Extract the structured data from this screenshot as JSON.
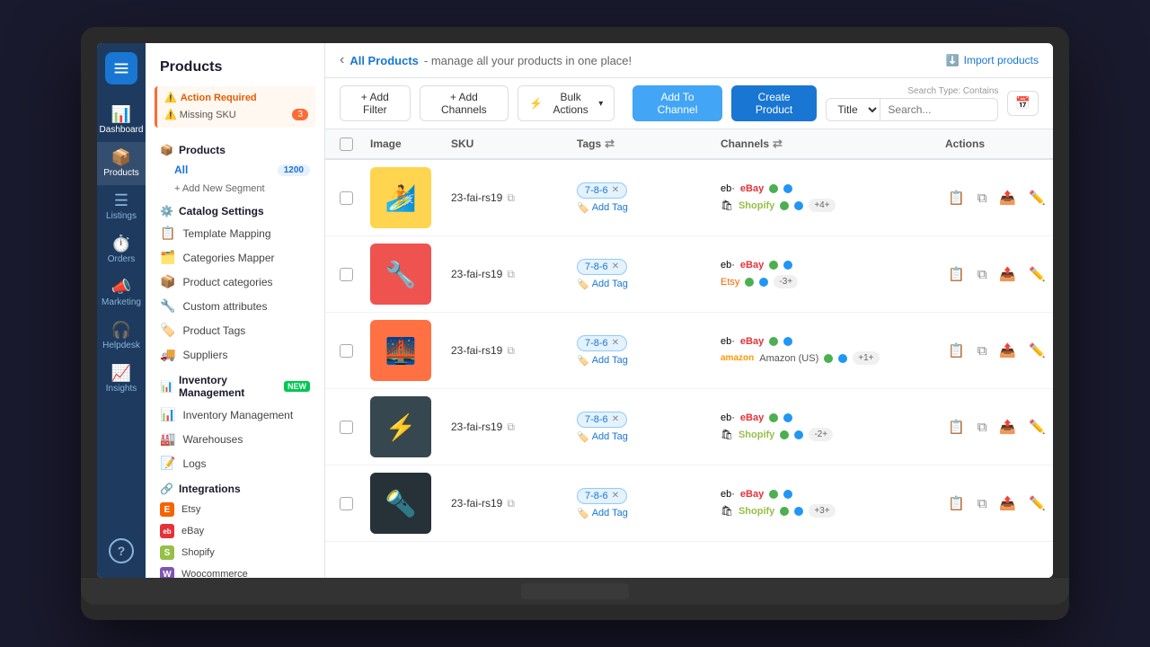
{
  "app": {
    "title": "Products"
  },
  "header": {
    "back_label": "‹",
    "breadcrumb_active": "All Products",
    "breadcrumb_desc": "- manage all your products in one place!",
    "import_label": "Import products"
  },
  "alerts": {
    "title": "Action Required",
    "items": [
      {
        "label": "Missing SKU",
        "count": "3"
      }
    ]
  },
  "sidebar": {
    "sections": {
      "products": {
        "title": "Products",
        "segments": [
          {
            "label": "All",
            "count": "1200",
            "active": true
          }
        ],
        "add_segment": "+ Add New Segment"
      },
      "catalog": {
        "title": "Catalog Settings",
        "items": [
          {
            "label": "Template Mapping",
            "icon": "📋"
          },
          {
            "label": "Categories Mapper",
            "icon": "🗂️"
          },
          {
            "label": "Product categories",
            "icon": "📦"
          },
          {
            "label": "Custom attributes",
            "icon": "🔧"
          },
          {
            "label": "Product Tags",
            "icon": "🏷️"
          },
          {
            "label": "Suppliers",
            "icon": "🚚"
          }
        ]
      },
      "inventory": {
        "title": "Inventory Management",
        "new_badge": "NEW",
        "items": [
          {
            "label": "Inventory Management",
            "icon": "📊"
          },
          {
            "label": "Warehouses",
            "icon": "🏭"
          },
          {
            "label": "Logs",
            "icon": "📝"
          }
        ]
      },
      "integrations": {
        "title": "Integrations",
        "items": [
          {
            "label": "Etsy",
            "type": "etsy"
          },
          {
            "label": "eBay",
            "type": "ebay"
          },
          {
            "label": "Shopify",
            "type": "shopify"
          },
          {
            "label": "Woocommerce",
            "type": "woo"
          }
        ]
      }
    }
  },
  "nav": {
    "items": [
      {
        "label": "Dashboard",
        "icon": "📊",
        "active": false
      },
      {
        "label": "Products",
        "icon": "📦",
        "active": true
      },
      {
        "label": "Listings",
        "icon": "☰",
        "active": false
      },
      {
        "label": "Orders",
        "icon": "⏱️",
        "active": false
      },
      {
        "label": "Marketing",
        "icon": "📣",
        "active": false
      },
      {
        "label": "Helpdesk",
        "icon": "🎧",
        "active": false
      },
      {
        "label": "Insights",
        "icon": "📈",
        "active": false
      }
    ]
  },
  "toolbar": {
    "add_filter": "+ Add Filter",
    "add_channels": "+ Add Channels",
    "bulk_actions": "Bulk Actions",
    "add_to_channel": "Add To Channel",
    "create_product": "Create Product",
    "search_type": "Search Type: Contains",
    "title_select": "Title",
    "search_placeholder": "Search..."
  },
  "table": {
    "columns": [
      "",
      "Image",
      "SKU",
      "Tags",
      "Channels",
      "Actions"
    ],
    "rows": [
      {
        "sku": "23-fai-rs19",
        "tag": "7-8-6",
        "channels": [
          {
            "name": "eBay",
            "type": "ebay",
            "status": [
              "green",
              "blue"
            ],
            "extra": null
          },
          {
            "name": "Shopify",
            "type": "shopify",
            "status": [
              "green",
              "blue"
            ],
            "extra": "+4+"
          }
        ],
        "color": "#ffd54f",
        "emoji": "🏄"
      },
      {
        "sku": "23-fai-rs19",
        "tag": "7-8-6",
        "channels": [
          {
            "name": "eBay",
            "type": "ebay",
            "status": [
              "green",
              "blue"
            ],
            "extra": null
          },
          {
            "name": "Etsy",
            "type": "etsy",
            "status": [
              "green",
              "blue"
            ],
            "extra": "-3+"
          }
        ],
        "color": "#ef5350",
        "emoji": "🔧"
      },
      {
        "sku": "23-fai-rs19",
        "tag": "7-8-6",
        "channels": [
          {
            "name": "eBay",
            "type": "ebay",
            "status": [
              "green",
              "blue"
            ],
            "extra": null
          },
          {
            "name": "Amazon (US)",
            "type": "amazon",
            "status": [
              "green",
              "blue"
            ],
            "extra": "+1+"
          }
        ],
        "color": "#ff7043",
        "emoji": "🌉"
      },
      {
        "sku": "23-fai-rs19",
        "tag": "7-8-6",
        "channels": [
          {
            "name": "eBay",
            "type": "ebay",
            "status": [
              "green",
              "blue"
            ],
            "extra": null
          },
          {
            "name": "Shopify",
            "type": "shopify",
            "status": [
              "green",
              "blue"
            ],
            "extra": "-2+"
          }
        ],
        "color": "#37474f",
        "emoji": "⚡"
      },
      {
        "sku": "23-fai-rs19",
        "tag": "7-8-6",
        "channels": [
          {
            "name": "eBay",
            "type": "ebay",
            "status": [
              "green",
              "blue"
            ],
            "extra": null
          },
          {
            "name": "Shopify",
            "type": "shopify",
            "status": [
              "green",
              "blue"
            ],
            "extra": "+3+"
          }
        ],
        "color": "#263238",
        "emoji": "🔦"
      }
    ]
  }
}
